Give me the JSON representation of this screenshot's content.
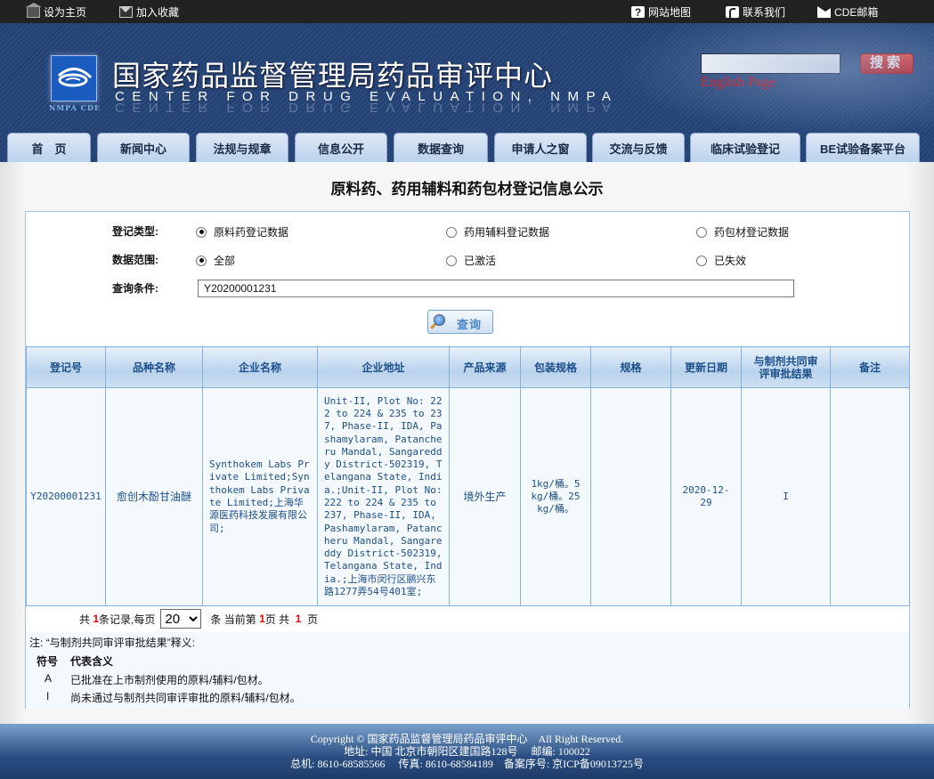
{
  "topbar": {
    "set_home": "设为主页",
    "add_favorite": "加入收藏",
    "sitemap": "网站地图",
    "contact": "联系我们",
    "mail": "CDE邮箱"
  },
  "header": {
    "logo_caption": "NMPA CDE",
    "title_cn": "国家药品监督管理局药品审评中心",
    "title_en": "CENTER FOR DRUG EVALUATION, NMPA",
    "search_value": "",
    "search_button": "搜索",
    "english_link": "English Page"
  },
  "nav": {
    "tabs": [
      {
        "label": "首　页"
      },
      {
        "label": "新闻中心"
      },
      {
        "label": "法规与规章"
      },
      {
        "label": "信息公开"
      },
      {
        "label": "数据查询"
      },
      {
        "label": "申请人之窗"
      },
      {
        "label": "交流与反馈"
      },
      {
        "label": "临床试验登记"
      },
      {
        "label": "BE试验备案平台"
      }
    ]
  },
  "page": {
    "title": "原料药、药用辅料和药包材登记信息公示"
  },
  "form": {
    "type_label": "登记类型:",
    "type_options": [
      {
        "label": "原料药登记数据",
        "selected": true
      },
      {
        "label": "药用辅料登记数据",
        "selected": false
      },
      {
        "label": "药包材登记数据",
        "selected": false
      }
    ],
    "scope_label": "数据范围:",
    "scope_options": [
      {
        "label": "全部",
        "selected": true
      },
      {
        "label": "已激活",
        "selected": false
      },
      {
        "label": "已失效",
        "selected": false
      }
    ],
    "query_label": "查询条件:",
    "query_value": "Y20200001231",
    "query_button": "查询"
  },
  "table": {
    "columns": [
      "登记号",
      "品种名称",
      "企业名称",
      "企业地址",
      "产品来源",
      "包装规格",
      "规格",
      "更新日期",
      "与制剂共同审评审批结果",
      "备注"
    ],
    "rows": [
      {
        "reg_no": "Y20200001231",
        "name": "愈创木酚甘油醚",
        "company": "Synthokem Labs Private Limited;Synthokem Labs Private Limited;上海华源医药科技发展有限公司;",
        "address": "Unit-II, Plot No: 222 to 224 & 235 to 237, Phase-II, IDA, Pashamylaram, Patancheru Mandal, Sangareddy District-502319, Telangana State, India.;Unit-II, Plot No: 222 to 224 & 235 to 237, Phase-II, IDA, Pashamylaram, Patancheru Mandal, Sangareddy District-502319, Telangana State, India.;上海市闵行区鹂兴东路1277弄54号401室;",
        "source": "境外生产",
        "packaging": "1kg/桶。5kg/桶。25kg/桶。",
        "spec": "",
        "updated": "2020-12-29",
        "review_result": "I",
        "remark": ""
      }
    ]
  },
  "pager": {
    "prefix": "共",
    "total_records": "1",
    "records_suffix": "条记录,每页",
    "page_size": "20",
    "current_prefix": "条 当前第",
    "current_page": "1",
    "page_word": "页 共",
    "total_pages": "1",
    "pages_suffix": "页"
  },
  "notes": {
    "title": "注: “与制剂共同审评审批结果”释义:",
    "head_symbol": "符号",
    "head_meaning": "代表含义",
    "rows": [
      {
        "symbol": "A",
        "meaning": "已批准在上市制剂使用的原料/辅料/包材。"
      },
      {
        "symbol": "I",
        "meaning": "尚未通过与制剂共同审评审批的原料/辅料/包材。"
      }
    ]
  },
  "footer": {
    "line1": "Copyright © 国家药品监督管理局药品审评中心　All Right Reserved.",
    "line2": "地址: 中国 北京市朝阳区建国路128号　 邮编: 100022",
    "line3": "总机: 8610-68585566　 传真: 8610-68584189　备案序号: 京ICP备09013725号"
  },
  "colors": {
    "accent_blue": "#1d4f8a",
    "header_red": "#e00000",
    "table_border": "#86b0da"
  }
}
